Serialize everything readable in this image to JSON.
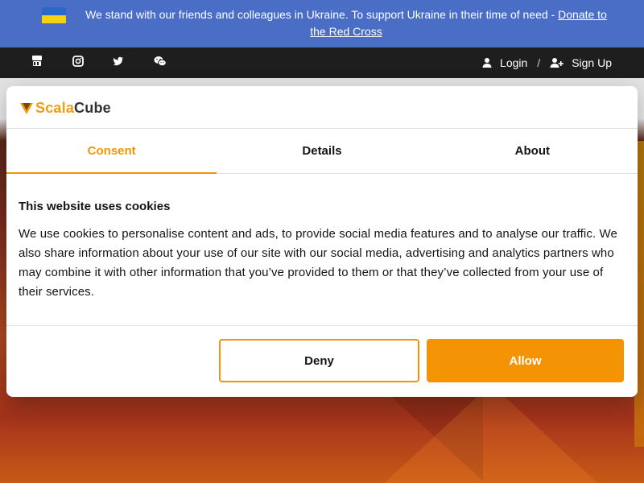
{
  "banner": {
    "text": "We stand with our friends and colleagues in Ukraine. To support Ukraine in their time of need - ",
    "link": "Donate to the Red Cross",
    "flag_colors": [
      "#2a69c9",
      "#f5d20f"
    ]
  },
  "topnav": {
    "social_icons": [
      "youtube-icon",
      "instagram-icon",
      "twitter-icon",
      "wechat-icon"
    ],
    "login": "Login",
    "separator": "/",
    "signup": "Sign Up"
  },
  "dialog": {
    "logo": {
      "part1": "Scala",
      "part2": "Cube"
    },
    "tabs": [
      {
        "label": "Consent",
        "active": true
      },
      {
        "label": "Details",
        "active": false
      },
      {
        "label": "About",
        "active": false
      }
    ],
    "title": "This website uses cookies",
    "body": "We use cookies to personalise content and ads, to provide social media features and to analyse our traffic. We also share information about your use of our site with our social media, advertising and analytics partners who may combine it with other information that you’ve provided to them or that they’ve collected from your use of their services.",
    "deny_label": "Deny",
    "allow_label": "Allow"
  },
  "colors": {
    "accent": "#f49404",
    "banner_bg": "#4a6ec6",
    "nav_bg": "#1e1e1e"
  }
}
